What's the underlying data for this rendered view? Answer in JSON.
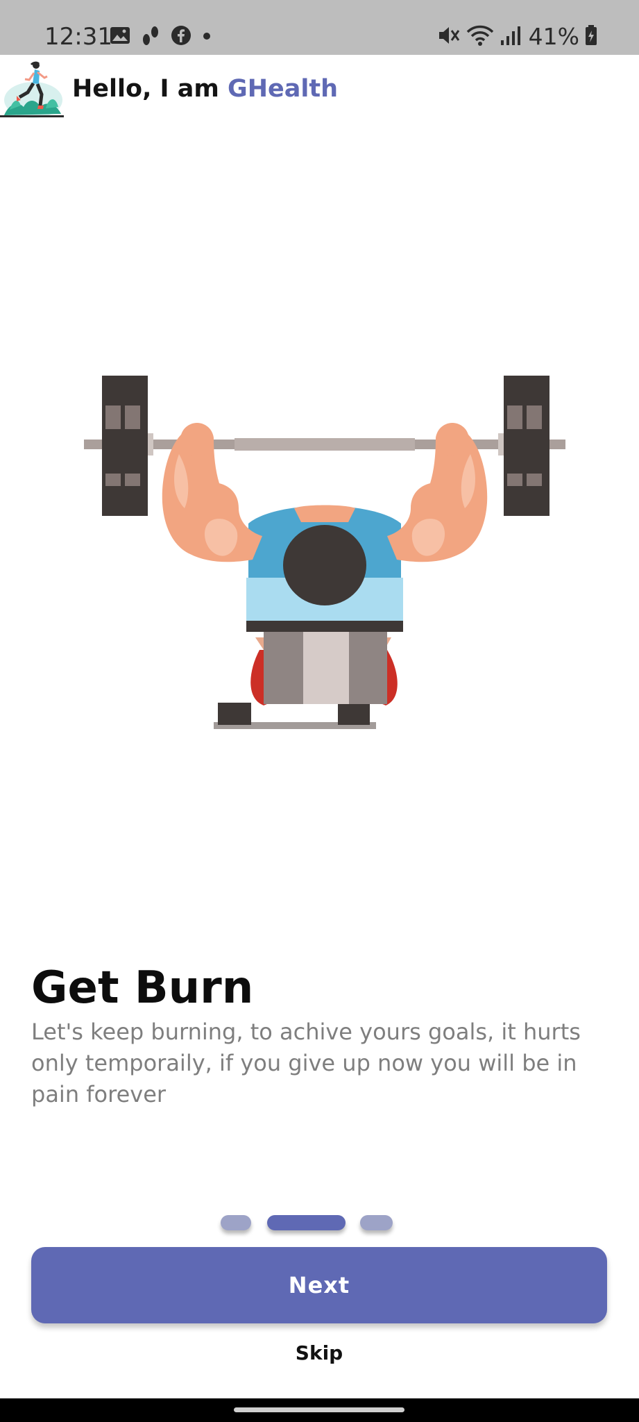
{
  "status_bar": {
    "time": "12:31",
    "battery_percent": "41%",
    "left_icons": [
      "gallery-icon",
      "steps-icon",
      "facebook-icon",
      "dot-icon"
    ],
    "right_icons": [
      "mute-icon",
      "wifi-icon",
      "signal-icon",
      "battery-charging-icon"
    ]
  },
  "header": {
    "greeting": "Hello, I am ",
    "brand": "GHealth",
    "logo_icon": "runner-logo-icon"
  },
  "slide": {
    "illustration_icon": "bench-press-illustration",
    "title": "Get Burn",
    "description": "Let's keep burning, to achive yours goals, it hurts only temporaily, if you give up now you will be in pain forever"
  },
  "pager": {
    "total": 3,
    "active_index": 1
  },
  "actions": {
    "next_label": "Next",
    "skip_label": "Skip"
  },
  "colors": {
    "accent": "#5f69b4",
    "accent_inactive": "#9da3c7",
    "status_bar_bg": "#bdbdbd",
    "title_text": "#0d0d0d",
    "body_text": "#7e7e7e"
  }
}
